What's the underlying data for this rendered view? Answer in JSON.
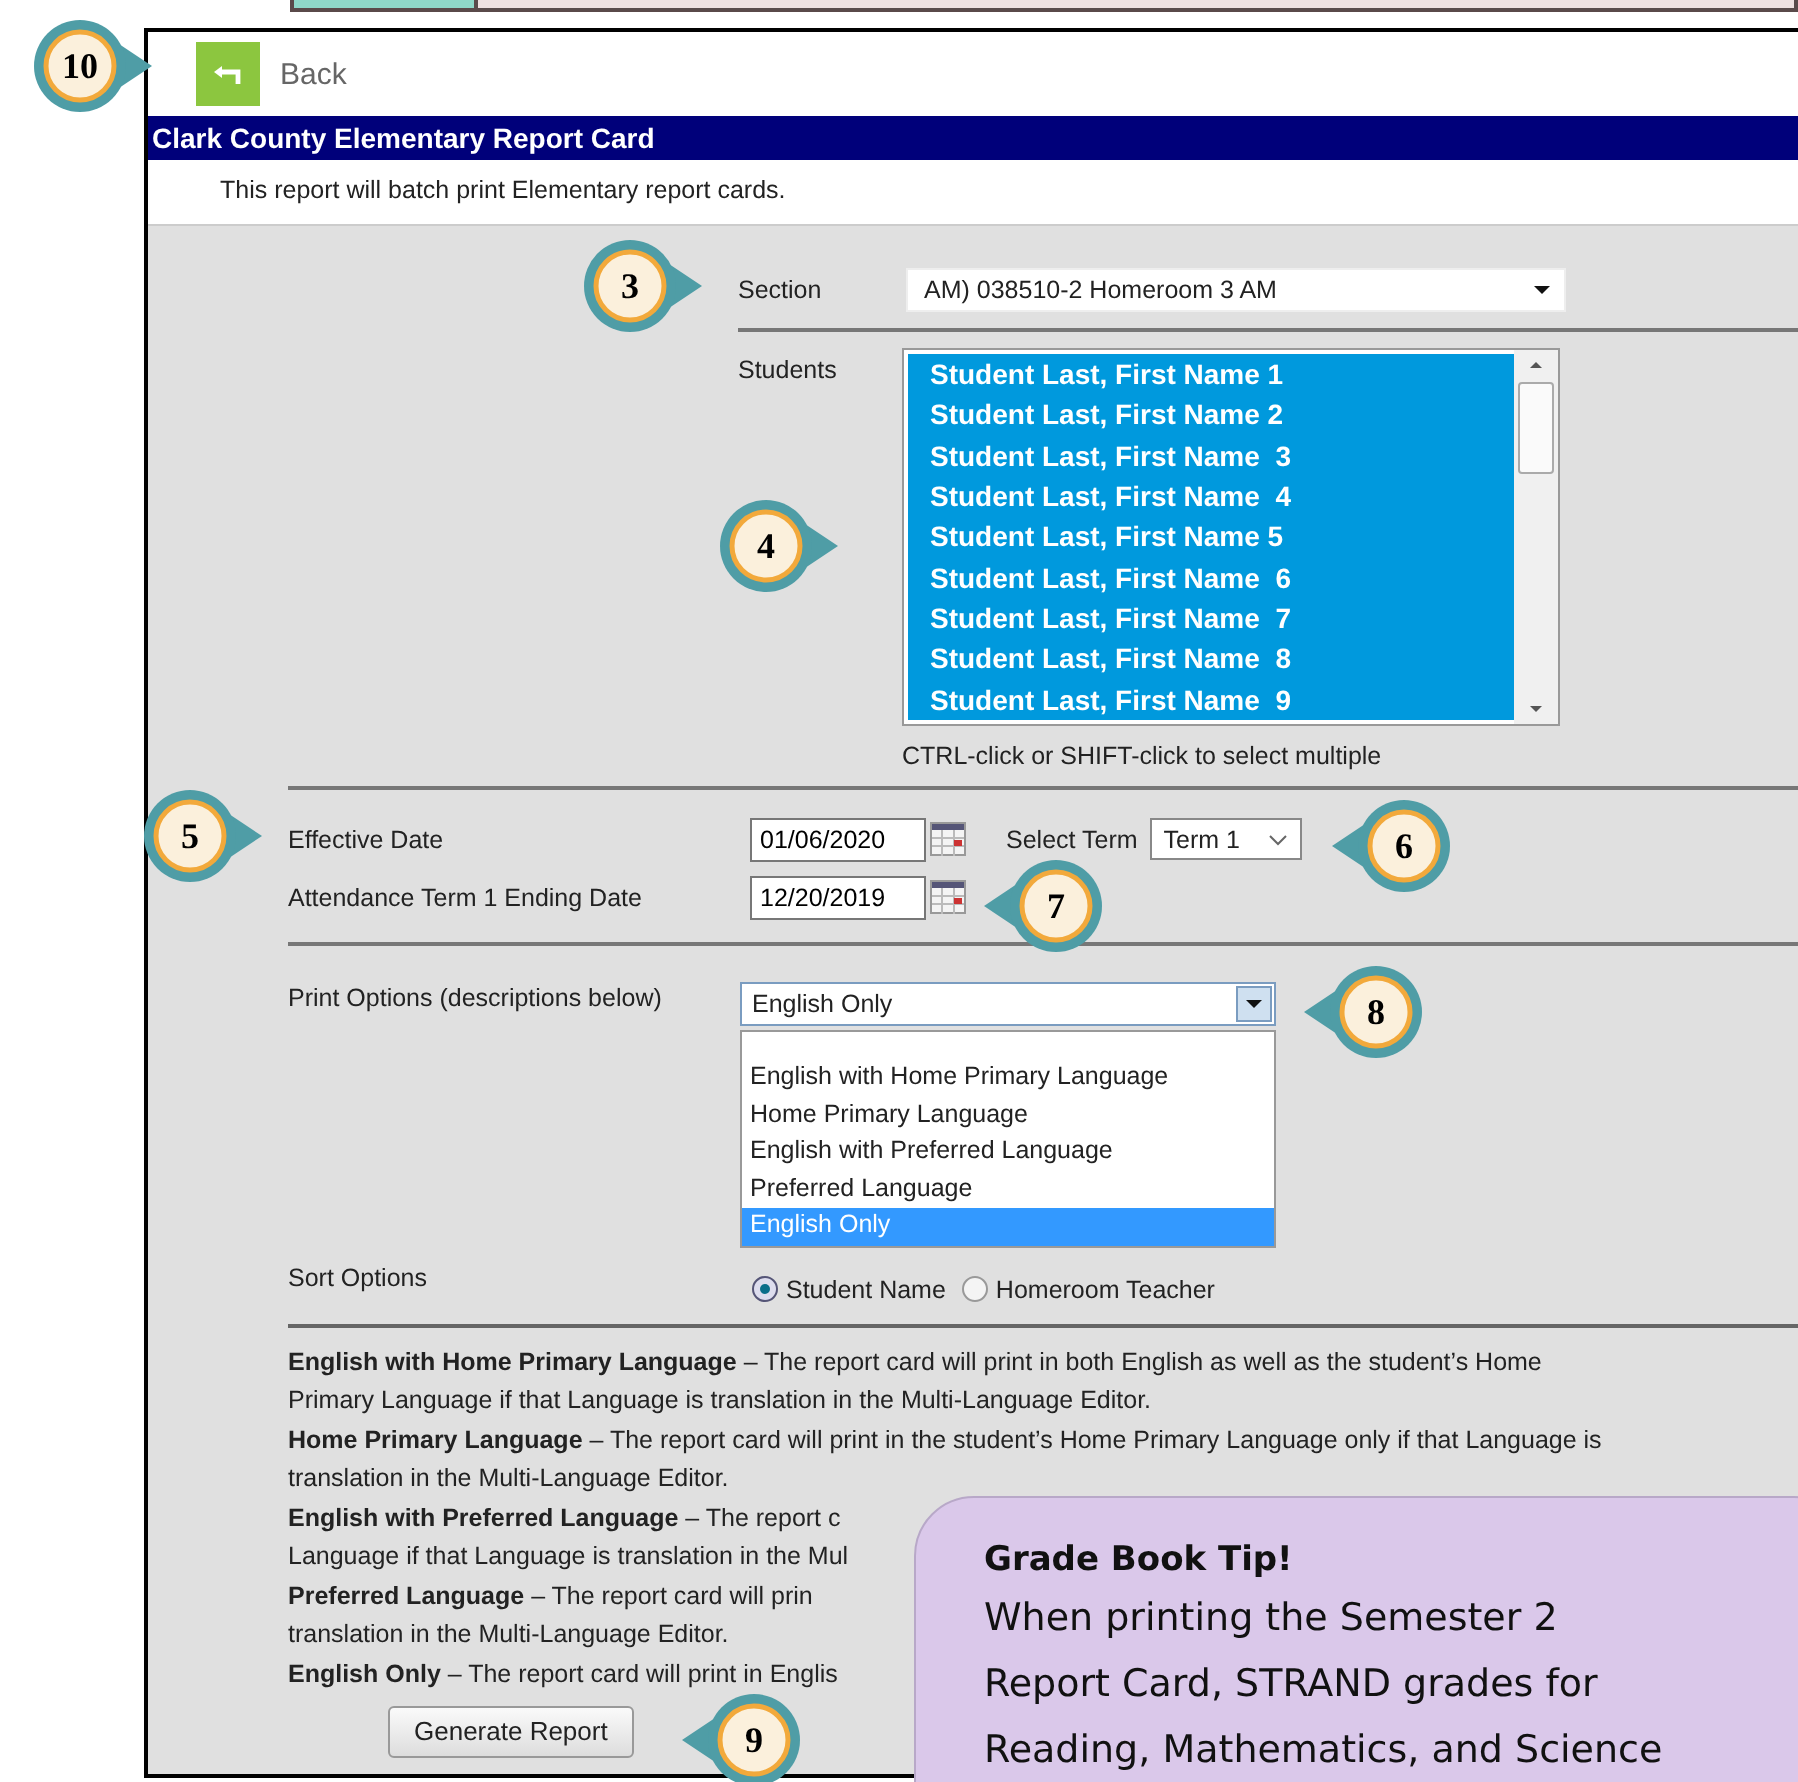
{
  "back_button": {
    "label": "Back"
  },
  "window": {
    "title": "Clark County Elementary Report Card",
    "subtitle": "This report will batch print Elementary report cards."
  },
  "section": {
    "label": "Section",
    "value": "AM) 038510-2 Homeroom 3 AM"
  },
  "students": {
    "label": "Students",
    "hint": "CTRL-click or SHIFT-click to select multiple",
    "items": [
      {
        "name": "Student Last, First Name 1",
        "selected": true
      },
      {
        "name": "Student Last, First Name 2",
        "selected": true
      },
      {
        "name": "Student Last, First Name  3",
        "selected": true
      },
      {
        "name": "Student Last, First Name  4",
        "selected": true
      },
      {
        "name": "Student Last, First Name 5",
        "selected": true
      },
      {
        "name": "Student Last, First Name  6",
        "selected": true
      },
      {
        "name": "Student Last, First Name  7",
        "selected": true
      },
      {
        "name": "Student Last, First Name  8",
        "selected": true
      },
      {
        "name": "Student Last, First Name  9",
        "selected": true
      }
    ]
  },
  "effective_date": {
    "label": "Effective Date",
    "value": "01/06/2020"
  },
  "select_term": {
    "label": "Select Term",
    "value": "Term 1"
  },
  "attendance_date": {
    "label": "Attendance Term 1 Ending Date",
    "value": "12/20/2019"
  },
  "print_options": {
    "label": "Print Options (descriptions below)",
    "value": "English Only",
    "expanded": true,
    "options": [
      {
        "label": "English with Home Primary Language",
        "selected": false
      },
      {
        "label": "Home Primary Language",
        "selected": false
      },
      {
        "label": "English with Preferred Language",
        "selected": false
      },
      {
        "label": "Preferred Language",
        "selected": false
      },
      {
        "label": "English Only",
        "selected": true
      }
    ]
  },
  "sort_options": {
    "label": "Sort Options",
    "options": [
      {
        "label": "Student Name",
        "selected": true
      },
      {
        "label": "Homeroom Teacher",
        "selected": false
      }
    ]
  },
  "descriptions": [
    {
      "lines": [
        "**English with Home Primary Language** – The report card will print in both English as well as the student’s Home",
        "Primary Language if that Language is translation in the Multi-Language Editor."
      ]
    },
    {
      "lines": [
        "**Home Primary Language** – The report card will print in the student’s Home Primary Language only if that Language is",
        "translation in the Multi-Language Editor."
      ]
    },
    {
      "lines": [
        "**English with Preferred Language** – The report c",
        "Language if that Language is translation in the Mul"
      ]
    },
    {
      "lines": [
        "**Preferred Language** – The report card will prin",
        "translation in the Multi-Language Editor."
      ]
    },
    {
      "lines": [
        "**English Only** – The report card will print in Englis"
      ]
    }
  ],
  "generate_button": {
    "label": "Generate Report"
  },
  "tip": {
    "title": "Grade Book Tip!",
    "lines": [
      "When printing the Semester 2",
      "Report Card, STRAND grades for",
      "Reading, Mathematics, and Science"
    ]
  },
  "callouts": [
    {
      "number": "10",
      "kind": "right"
    },
    {
      "number": "3",
      "kind": "right"
    },
    {
      "number": "4",
      "kind": "right"
    },
    {
      "number": "5",
      "kind": "right"
    },
    {
      "number": "6",
      "kind": "left"
    },
    {
      "number": "7",
      "kind": "left"
    },
    {
      "number": "8",
      "kind": "left"
    },
    {
      "number": "9",
      "kind": "left"
    }
  ]
}
